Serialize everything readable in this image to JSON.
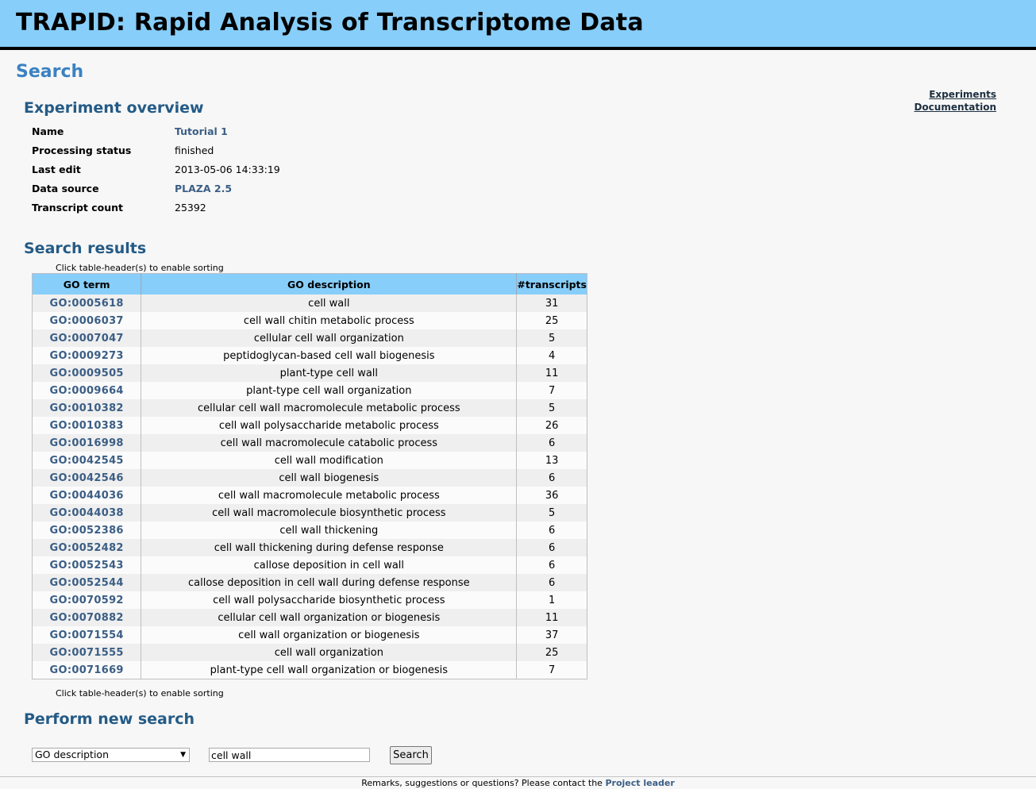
{
  "app": {
    "title": "TRAPID: Rapid Analysis of Transcriptome Data"
  },
  "page": {
    "title": "Search"
  },
  "nav": {
    "experiments": "Experiments",
    "documentation": "Documentation"
  },
  "overview": {
    "heading": "Experiment overview",
    "rows": [
      {
        "label": "Name",
        "value": "Tutorial 1"
      },
      {
        "label": "Processing status",
        "value": "finished"
      },
      {
        "label": "Last edit",
        "value": "2013-05-06 14:33:19"
      },
      {
        "label": "Data source",
        "value": "PLAZA 2.5"
      },
      {
        "label": "Transcript count",
        "value": "25392"
      }
    ]
  },
  "results": {
    "heading": "Search results",
    "sort_hint": "Click table-header(s) to enable sorting",
    "columns": [
      "GO term",
      "GO description",
      "#transcripts"
    ],
    "rows": [
      [
        "GO:0005618",
        "cell wall",
        "31"
      ],
      [
        "GO:0006037",
        "cell wall chitin metabolic process",
        "25"
      ],
      [
        "GO:0007047",
        "cellular cell wall organization",
        "5"
      ],
      [
        "GO:0009273",
        "peptidoglycan-based cell wall biogenesis",
        "4"
      ],
      [
        "GO:0009505",
        "plant-type cell wall",
        "11"
      ],
      [
        "GO:0009664",
        "plant-type cell wall organization",
        "7"
      ],
      [
        "GO:0010382",
        "cellular cell wall macromolecule metabolic process",
        "5"
      ],
      [
        "GO:0010383",
        "cell wall polysaccharide metabolic process",
        "26"
      ],
      [
        "GO:0016998",
        "cell wall macromolecule catabolic process",
        "6"
      ],
      [
        "GO:0042545",
        "cell wall modification",
        "13"
      ],
      [
        "GO:0042546",
        "cell wall biogenesis",
        "6"
      ],
      [
        "GO:0044036",
        "cell wall macromolecule metabolic process",
        "36"
      ],
      [
        "GO:0044038",
        "cell wall macromolecule biosynthetic process",
        "5"
      ],
      [
        "GO:0052386",
        "cell wall thickening",
        "6"
      ],
      [
        "GO:0052482",
        "cell wall thickening during defense response",
        "6"
      ],
      [
        "GO:0052543",
        "callose deposition in cell wall",
        "6"
      ],
      [
        "GO:0052544",
        "callose deposition in cell wall during defense response",
        "6"
      ],
      [
        "GO:0070592",
        "cell wall polysaccharide biosynthetic process",
        "1"
      ],
      [
        "GO:0070882",
        "cellular cell wall organization or biogenesis",
        "11"
      ],
      [
        "GO:0071554",
        "cell wall organization or biogenesis",
        "37"
      ],
      [
        "GO:0071555",
        "cell wall organization",
        "25"
      ],
      [
        "GO:0071669",
        "plant-type cell wall organization or biogenesis",
        "7"
      ]
    ]
  },
  "new_search": {
    "heading": "Perform new search",
    "type_selected": "GO description",
    "query_value": "cell wall",
    "button_label": "Search"
  },
  "footer": {
    "text": "Remarks, suggestions or questions? Please contact the",
    "link": "Project leader"
  },
  "colors": {
    "header_bg": "#87cefa",
    "title_blue": "#3a82c2",
    "section_blue": "#245b86",
    "link": "#3b5e85"
  }
}
